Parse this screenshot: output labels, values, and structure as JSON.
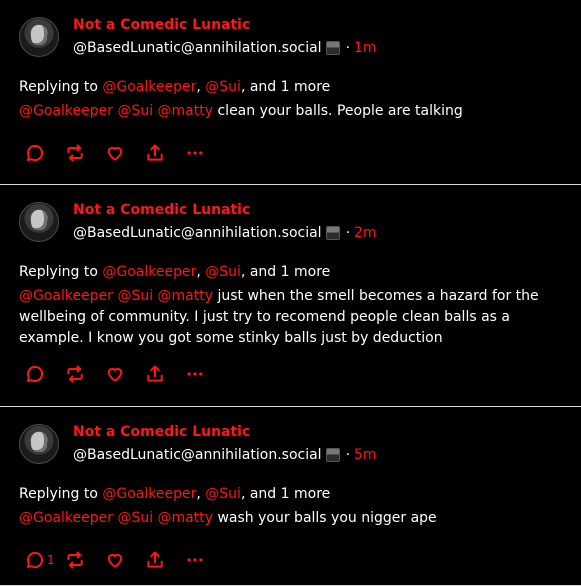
{
  "posts": [
    {
      "name": "Not a Comedic Lunatic",
      "handle": "@BasedLunatic@annihilation.social",
      "time": "1m",
      "replying": {
        "prefix": "Replying to ",
        "m1": "@Goalkeeper",
        "sep1": ", ",
        "m2": "@Sui",
        "suffix": ", and 1 more"
      },
      "text": {
        "m1": "@Goalkeeper",
        "m2": "@Sui",
        "m3": "@matty",
        "body": " clean your balls.  People are talking"
      },
      "reply_count": ""
    },
    {
      "name": "Not a Comedic Lunatic",
      "handle": "@BasedLunatic@annihilation.social",
      "time": "2m",
      "replying": {
        "prefix": "Replying to ",
        "m1": "@Goalkeeper",
        "sep1": ", ",
        "m2": "@Sui",
        "suffix": ", and 1 more"
      },
      "text": {
        "m1": "@Goalkeeper",
        "m2": "@Sui",
        "m3": "@matty",
        "body": " just when the smell becomes a hazard for the wellbeing of community. I just try to recomend people clean balls as a example. I know you got some stinky balls just by deduction"
      },
      "reply_count": ""
    },
    {
      "name": "Not a Comedic Lunatic",
      "handle": "@BasedLunatic@annihilation.social",
      "time": "5m",
      "replying": {
        "prefix": "Replying to ",
        "m1": "@Goalkeeper",
        "sep1": ", ",
        "m2": "@Sui",
        "suffix": ", and 1 more"
      },
      "text": {
        "m1": "@Goalkeeper",
        "m2": "@Sui",
        "m3": "@matty",
        "body": " wash your balls you nigger ape"
      },
      "reply_count": "1"
    }
  ],
  "dot": "·",
  "colors": {
    "accent": "#ff1616",
    "background": "#000000",
    "text": "#ffffff",
    "divider": "#d9d9d9"
  },
  "icons": [
    "reply-icon",
    "repeat-icon",
    "heart-icon",
    "share-icon",
    "more-icon"
  ]
}
